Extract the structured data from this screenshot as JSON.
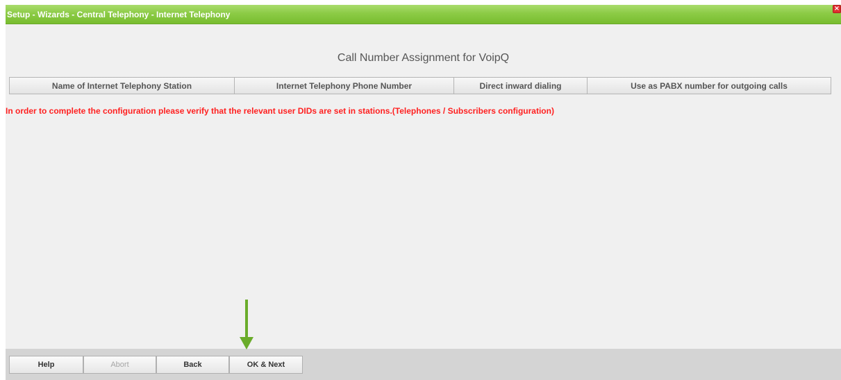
{
  "window": {
    "title": "Setup - Wizards - Central Telephony - Internet Telephony",
    "close_icon": "close-icon"
  },
  "main": {
    "heading": "Call Number Assignment for VoipQ",
    "table": {
      "columns": [
        "Name of Internet Telephony Station",
        "Internet Telephony Phone Number",
        "Direct inward dialing",
        "Use as PABX number for outgoing calls"
      ],
      "rows": []
    },
    "warning": "In order to complete the configuration please verify that the relevant user DIDs are set in stations.(Telephones / Subscribers configuration)"
  },
  "footer": {
    "buttons": {
      "help": "Help",
      "abort": "Abort",
      "back": "Back",
      "ok_next": "OK & Next"
    }
  },
  "annotation": {
    "arrow_icon": "arrow-down-icon",
    "arrow_color": "#6aac2a"
  },
  "colors": {
    "title_bar": "#8ccb46",
    "warning_text": "#ff2020",
    "close_button": "#e03030"
  }
}
